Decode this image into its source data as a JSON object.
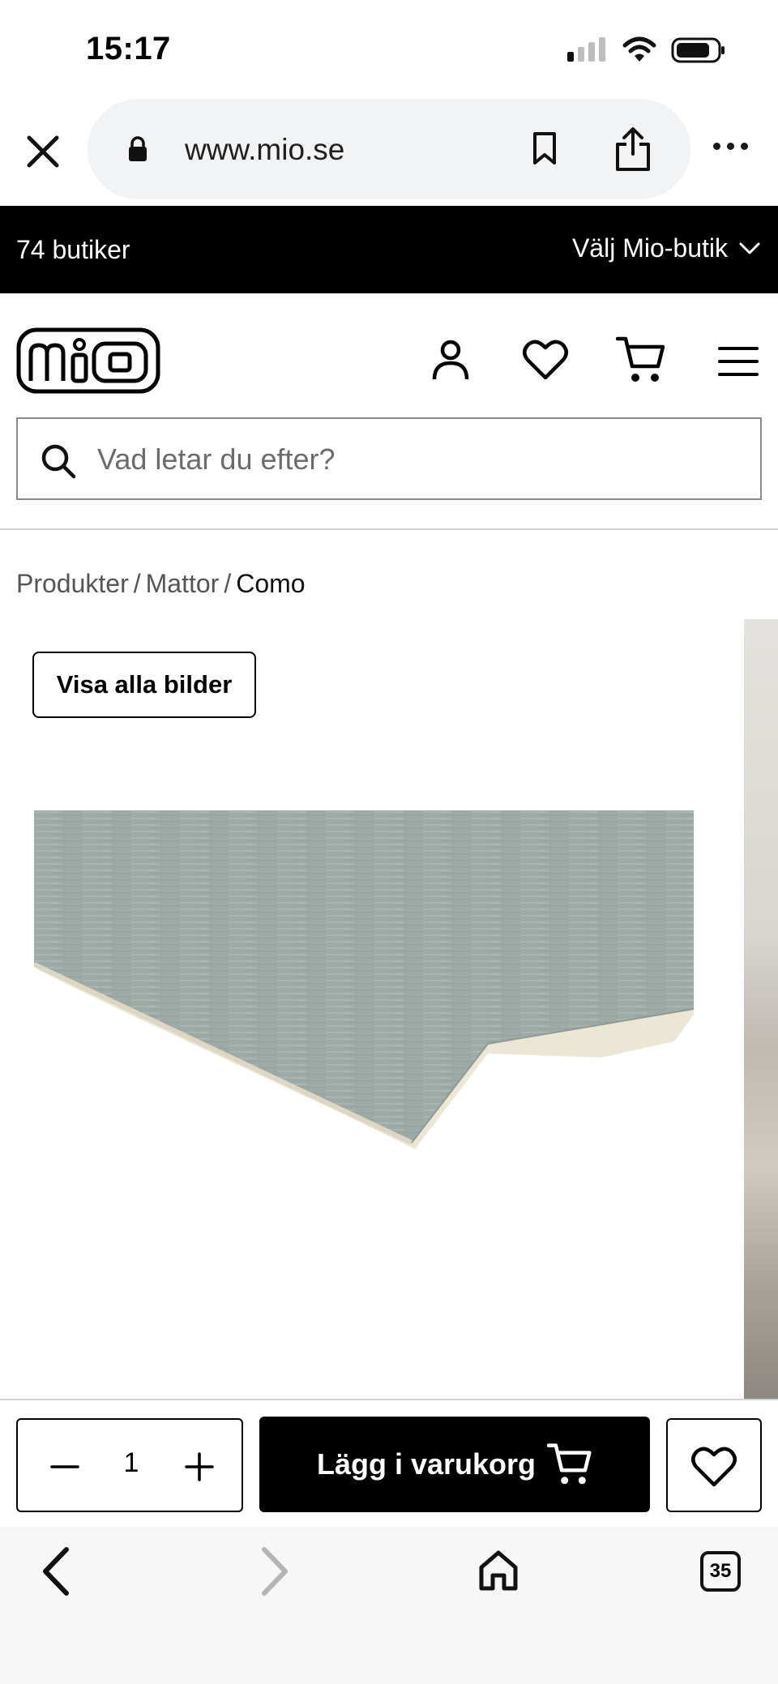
{
  "status_bar": {
    "time": "15:17"
  },
  "browser": {
    "url": "www.mio.se",
    "tab_count": "35"
  },
  "store_bar": {
    "stores": "74 butiker",
    "select_label": "Välj Mio-butik"
  },
  "header": {
    "logo": "mio"
  },
  "search": {
    "placeholder": "Vad letar du efter?"
  },
  "breadcrumb": {
    "items": [
      "Produkter",
      "Mattor"
    ],
    "separator": "/",
    "current": "Como"
  },
  "gallery": {
    "show_all_label": "Visa alla bilder",
    "rug_color": "#9aa8a4"
  },
  "purchase": {
    "quantity": "1",
    "add_to_cart_label": "Lägg i varukorg"
  },
  "icons": [
    "close-icon",
    "lock-icon",
    "bookmark-icon",
    "share-icon",
    "more-icon",
    "chevron-down-icon",
    "account-icon",
    "heart-icon",
    "cart-icon",
    "menu-icon",
    "search-icon",
    "minus-icon",
    "plus-icon",
    "back-icon",
    "forward-icon",
    "home-icon",
    "tabs-icon"
  ]
}
